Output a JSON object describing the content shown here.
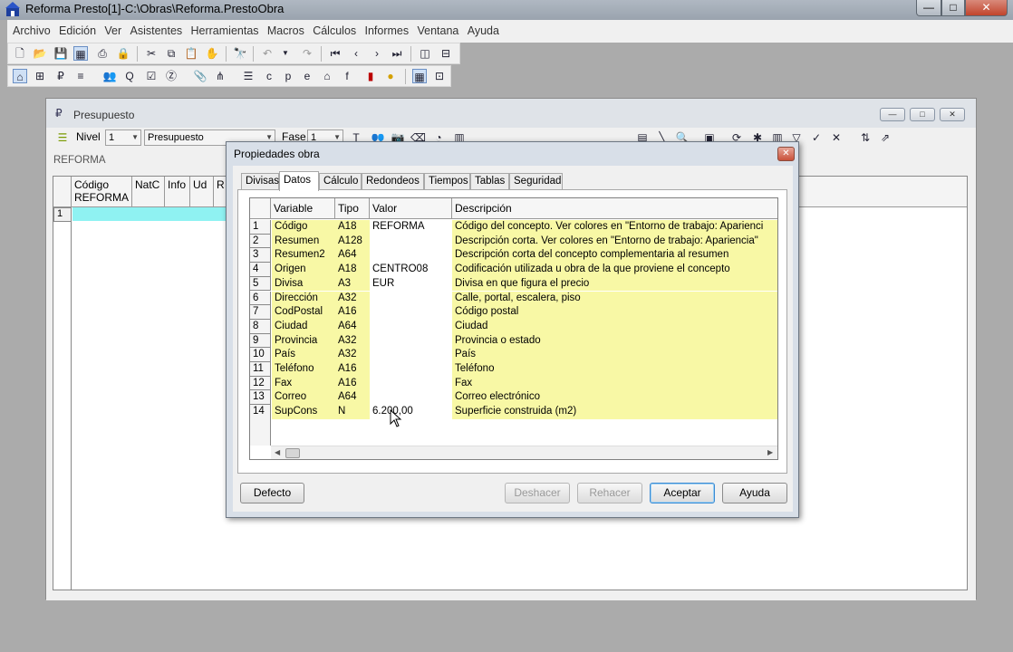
{
  "window": {
    "title": "Reforma Presto[1]-C:\\Obras\\Reforma.PrestoObra",
    "min_glyph": "—",
    "max_glyph": "□",
    "close_glyph": "✕"
  },
  "menu": [
    "Archivo",
    "Edición",
    "Ver",
    "Asistentes",
    "Herramientas",
    "Macros",
    "Cálculos",
    "Informes",
    "Ventana",
    "Ayuda"
  ],
  "child_window": {
    "title": "Presupuesto",
    "nivel_label": "Nivel",
    "nivel_value": "1",
    "view_value": "Presupuesto",
    "fase_label": "Fase",
    "fase_value": "1",
    "root_label": "REFORMA",
    "grid_headers": [
      "Código\nREFORMA",
      "NatC",
      "Info",
      "Ud",
      "R"
    ],
    "first_row_num": "1"
  },
  "dialog": {
    "title": "Propiedades obra",
    "close_glyph": "✕",
    "tabs": [
      "Divisas",
      "Datos",
      "Cálculo",
      "Redondeos",
      "Tiempos",
      "Tablas",
      "Seguridad"
    ],
    "active_tab": "Datos",
    "columns": [
      "Variable",
      "Tipo",
      "Valor",
      "Descripción"
    ],
    "rows": [
      {
        "n": "1",
        "variable": "Código",
        "tipo": "A18",
        "valor": "REFORMA",
        "descripcion": "Código del concepto. Ver colores en \"Entorno de trabajo: Aparienci"
      },
      {
        "n": "2",
        "variable": "Resumen",
        "tipo": "A128",
        "valor": "",
        "descripcion": "Descripción corta. Ver colores en \"Entorno de trabajo: Apariencia\""
      },
      {
        "n": "3",
        "variable": "Resumen2",
        "tipo": "A64",
        "valor": "",
        "descripcion": "Descripción corta del concepto complementaria al resumen"
      },
      {
        "n": "4",
        "variable": "Origen",
        "tipo": "A18",
        "valor": "CENTRO08",
        "descripcion": "Codificación utilizada u obra de la que proviene el concepto"
      },
      {
        "n": "5",
        "variable": "Divisa",
        "tipo": "A3",
        "valor": "EUR",
        "descripcion": "Divisa en que figura el precio"
      },
      {
        "n": "6",
        "variable": "Dirección",
        "tipo": "A32",
        "valor": "",
        "descripcion": "Calle, portal, escalera, piso"
      },
      {
        "n": "7",
        "variable": "CodPostal",
        "tipo": "A16",
        "valor": "",
        "descripcion": "Código postal"
      },
      {
        "n": "8",
        "variable": "Ciudad",
        "tipo": "A64",
        "valor": "",
        "descripcion": "Ciudad"
      },
      {
        "n": "9",
        "variable": "Provincia",
        "tipo": "A32",
        "valor": "",
        "descripcion": "Provincia o estado"
      },
      {
        "n": "10",
        "variable": "País",
        "tipo": "A32",
        "valor": "",
        "descripcion": "País"
      },
      {
        "n": "11",
        "variable": "Teléfono",
        "tipo": "A16",
        "valor": "",
        "descripcion": "Teléfono"
      },
      {
        "n": "12",
        "variable": "Fax",
        "tipo": "A16",
        "valor": "",
        "descripcion": "Fax"
      },
      {
        "n": "13",
        "variable": "Correo",
        "tipo": "A64",
        "valor": "",
        "descripcion": "Correo electrónico"
      },
      {
        "n": "14",
        "variable": "SupCons",
        "tipo": "N",
        "valor": "6.200,00",
        "descripcion": "Superficie construida (m2)"
      }
    ],
    "buttons": {
      "defecto": "Defecto",
      "deshacer": "Deshacer",
      "rehacer": "Rehacer",
      "aceptar": "Aceptar",
      "ayuda": "Ayuda"
    }
  },
  "colors": {
    "row_highlight": "#f8f8a5",
    "selected_row": "#8ff2f2",
    "close_red": "#c9513a"
  }
}
